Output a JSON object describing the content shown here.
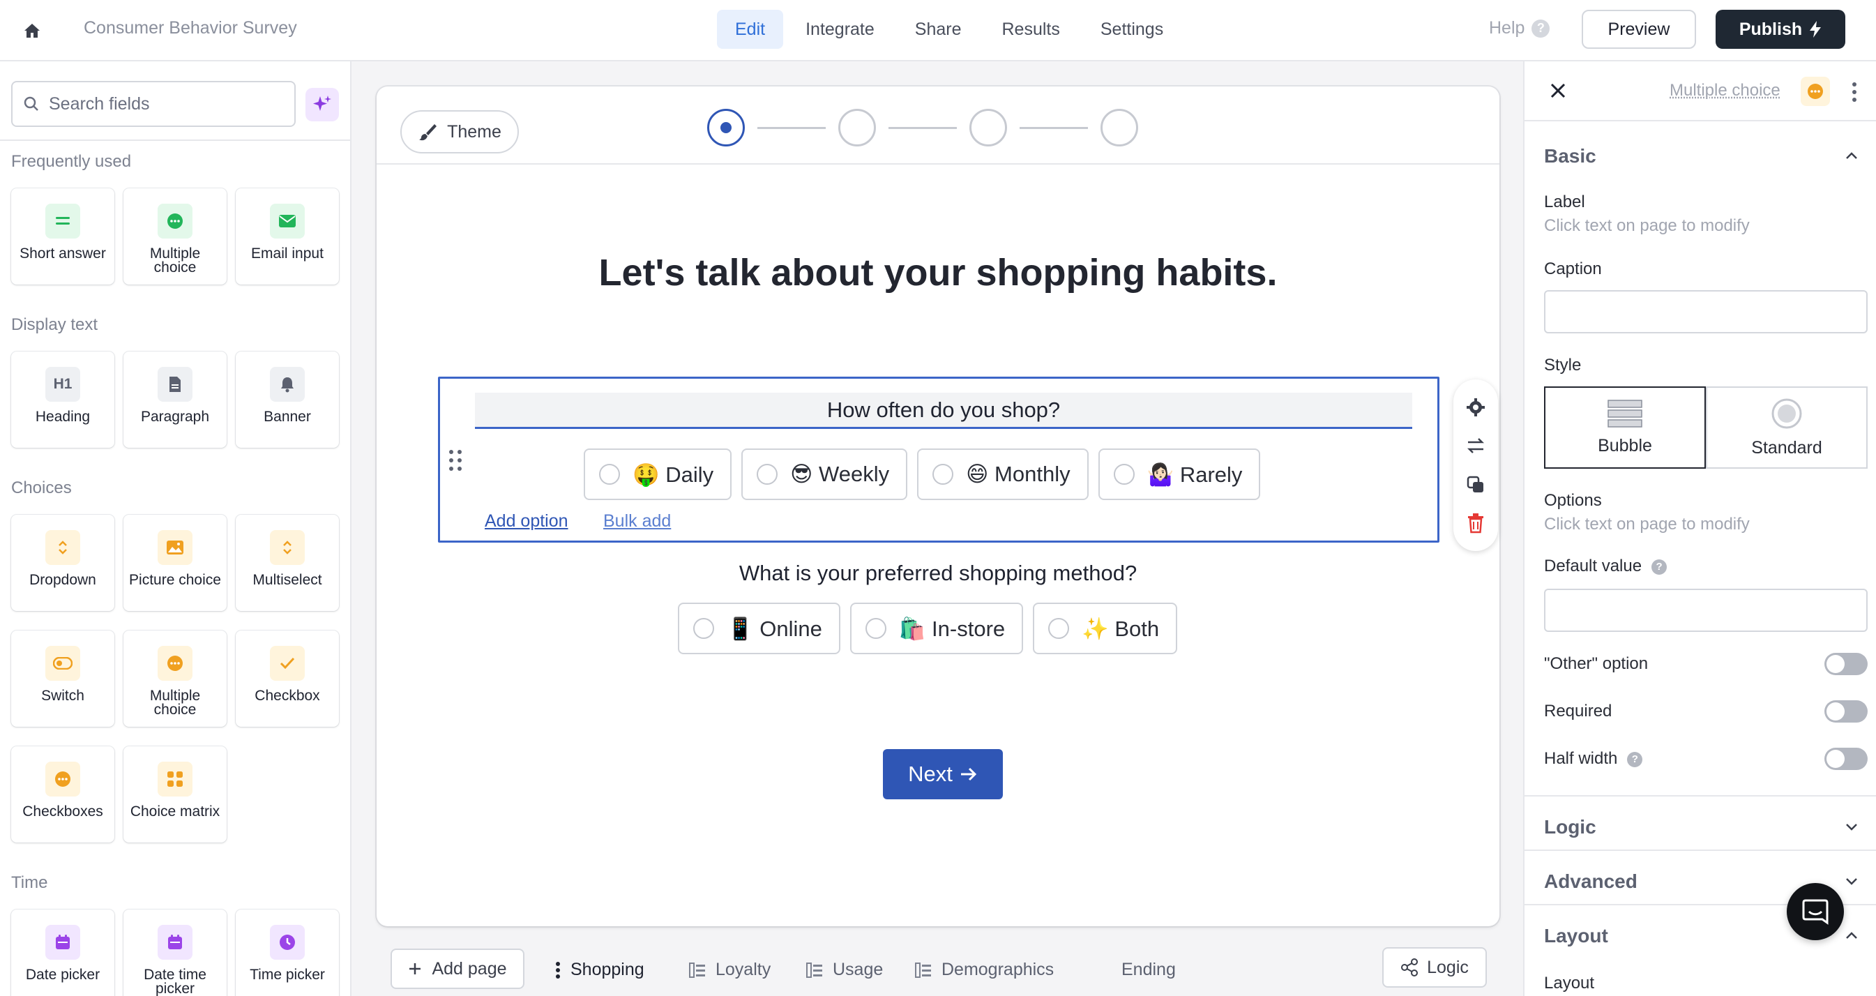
{
  "topbar": {
    "form_title": "Consumer Behavior Survey",
    "nav": [
      "Edit",
      "Integrate",
      "Share",
      "Results",
      "Settings"
    ],
    "active_nav": "Edit",
    "help_label": "Help",
    "preview_label": "Preview",
    "publish_label": "Publish"
  },
  "sidebar_left": {
    "search_placeholder": "Search fields",
    "sections": {
      "frequently_used": {
        "title": "Frequently used",
        "items": [
          {
            "label": "Short answer",
            "icon": "short-answer-icon"
          },
          {
            "label": "Multiple choice",
            "icon": "multiple-choice-icon"
          },
          {
            "label": "Email input",
            "icon": "email-icon"
          }
        ]
      },
      "display_text": {
        "title": "Display text",
        "items": [
          {
            "label": "Heading",
            "icon": "heading-icon"
          },
          {
            "label": "Paragraph",
            "icon": "paragraph-icon"
          },
          {
            "label": "Banner",
            "icon": "bell-icon"
          }
        ]
      },
      "choices": {
        "title": "Choices",
        "items": [
          {
            "label": "Dropdown",
            "icon": "dropdown-icon"
          },
          {
            "label": "Picture choice",
            "icon": "picture-icon"
          },
          {
            "label": "Multiselect",
            "icon": "multiselect-icon"
          },
          {
            "label": "Switch",
            "icon": "switch-icon"
          },
          {
            "label": "Multiple choice",
            "icon": "multiple-choice-icon"
          },
          {
            "label": "Checkbox",
            "icon": "checkbox-icon"
          },
          {
            "label": "Checkboxes",
            "icon": "checkboxes-icon"
          },
          {
            "label": "Choice matrix",
            "icon": "matrix-icon"
          }
        ]
      },
      "time": {
        "title": "Time",
        "items": [
          {
            "label": "Date picker",
            "icon": "calendar-icon"
          },
          {
            "label": "Date time picker",
            "icon": "calendar-icon"
          },
          {
            "label": "Time picker",
            "icon": "clock-icon"
          }
        ]
      }
    }
  },
  "canvas": {
    "theme_label": "Theme",
    "steps": 4,
    "current_step": 1,
    "heading": "Let's talk about your shopping habits.",
    "question1": {
      "label": "How often do you shop?",
      "options": [
        "🤑 Daily",
        "😎 Weekly",
        "😄 Monthly",
        "🤷🏻‍♀️ Rarely"
      ],
      "add_option": "Add option",
      "bulk_add": "Bulk add"
    },
    "question2": {
      "label": "What is your preferred shopping method?",
      "options": [
        "📱 Online",
        "🛍️ In-store",
        "✨ Both"
      ]
    },
    "next_label": "Next"
  },
  "pagebar": {
    "add_page_label": "Add page",
    "tabs": [
      "Shopping",
      "Loyalty",
      "Usage",
      "Demographics",
      "Ending"
    ],
    "active_tab": "Shopping",
    "logic_label": "Logic"
  },
  "sidebar_right": {
    "field_type": "Multiple choice",
    "basic_title": "Basic",
    "label_title": "Label",
    "label_hint": "Click text on page to modify",
    "caption_title": "Caption",
    "style_title": "Style",
    "style_options": [
      "Bubble",
      "Standard"
    ],
    "style_selected": "Bubble",
    "options_title": "Options",
    "options_hint": "Click text on page to modify",
    "default_value_title": "Default value",
    "other_option_label": "\"Other\" option",
    "required_label": "Required",
    "half_width_label": "Half width",
    "toggles": {
      "other_option": false,
      "required": false,
      "half_width": false
    },
    "logic_title": "Logic",
    "advanced_title": "Advanced",
    "layout_title": "Layout",
    "layout_sub": "Layout"
  },
  "colors": {
    "accent": "#2f56b5",
    "publish_bg": "#1f2833",
    "selected_border": "#3c65c8"
  }
}
